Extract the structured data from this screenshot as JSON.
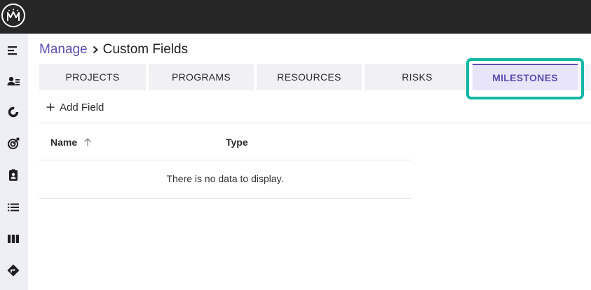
{
  "brand": {
    "logo_name": "app-logo"
  },
  "sidebar": {
    "items": [
      {
        "name": "sidebar-item-menu",
        "icon": "menu-icon"
      },
      {
        "name": "sidebar-item-users",
        "icon": "user-list-icon"
      },
      {
        "name": "sidebar-item-portfolio",
        "icon": "donut-chart-icon"
      },
      {
        "name": "sidebar-item-goals",
        "icon": "target-icon"
      },
      {
        "name": "sidebar-item-assignments",
        "icon": "clipboard-user-icon"
      },
      {
        "name": "sidebar-item-list",
        "icon": "list-icon"
      },
      {
        "name": "sidebar-item-board",
        "icon": "board-columns-icon"
      },
      {
        "name": "sidebar-item-roadmap",
        "icon": "direction-sign-icon"
      }
    ]
  },
  "breadcrumb": {
    "parent": "Manage",
    "current": "Custom Fields"
  },
  "tabs": [
    {
      "label": "PROJECTS",
      "active": false
    },
    {
      "label": "PROGRAMS",
      "active": false
    },
    {
      "label": "RESOURCES",
      "active": false
    },
    {
      "label": "RISKS",
      "active": false
    },
    {
      "label": "MILESTONES",
      "active": true
    }
  ],
  "toolbar": {
    "add_field_label": "Add Field"
  },
  "table": {
    "columns": [
      {
        "label": "Name",
        "sort": "ascending"
      },
      {
        "label": "Type"
      }
    ],
    "empty_message": "There is no data to display."
  },
  "colors": {
    "accent": "#5b4fb3",
    "highlight": "#13b8a6",
    "topbar": "#262626",
    "sidebar": "#eeeef5",
    "active_tab": "#e8e5fb"
  }
}
